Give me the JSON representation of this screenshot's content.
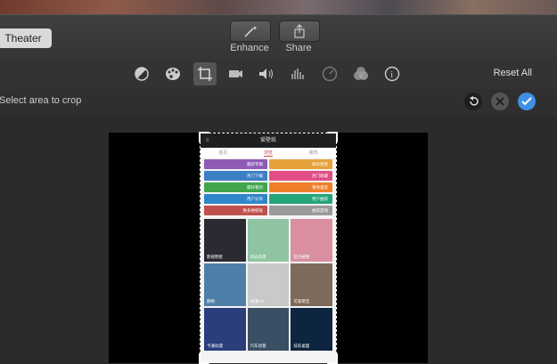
{
  "toolbar": {
    "theater_label": "Theater",
    "enhance_label": "Enhance",
    "share_label": "Share"
  },
  "adjustments": {
    "icons": [
      "color-balance-icon",
      "color-correction-icon",
      "crop-icon",
      "stabilization-icon",
      "volume-icon",
      "equalizer-icon",
      "speed-icon",
      "filter-icon",
      "info-icon"
    ],
    "reset_label": "Reset All"
  },
  "crop": {
    "message": "Select area to crop"
  },
  "phone": {
    "title": "爱壁纸",
    "tabs": [
      "首页",
      "浏览",
      "装饰"
    ],
    "categories": [
      {
        "label": "最新专辑",
        "color": "#8e5bb5"
      },
      {
        "label": "每日更新",
        "color": "#e6a23a"
      },
      {
        "label": "热门下载",
        "color": "#3d7fc4"
      },
      {
        "label": "热门收藏",
        "color": "#e24f84"
      },
      {
        "label": "最好看的",
        "color": "#41a64b"
      },
      {
        "label": "猜你喜欢",
        "color": "#ef7f2b"
      },
      {
        "label": "用户分享",
        "color": "#2f86c9"
      },
      {
        "label": "用户推荐",
        "color": "#25a57a"
      },
      {
        "label": "换多换壁纸",
        "color": "#c0504d"
      },
      {
        "label": "推荐游戏",
        "color": "#9a9a9a"
      }
    ],
    "photos": [
      {
        "label": "影视明星",
        "bg": "#2a2a33"
      },
      {
        "label": "风光风景",
        "bg": "#8fc4a2"
      },
      {
        "label": "花卉植物",
        "bg": "#d98fa0"
      },
      {
        "label": "静物",
        "bg": "#4f7fa8"
      },
      {
        "label": "动漫CG",
        "bg": "#c9c9c9"
      },
      {
        "label": "可爱萌宝",
        "bg": "#7d6a5a"
      },
      {
        "label": "卡通动漫",
        "bg": "#2b3d7a"
      },
      {
        "label": "汽车创意",
        "bg": "#3a4f63"
      },
      {
        "label": "炫彩桌面",
        "bg": "#0d2540"
      }
    ]
  }
}
